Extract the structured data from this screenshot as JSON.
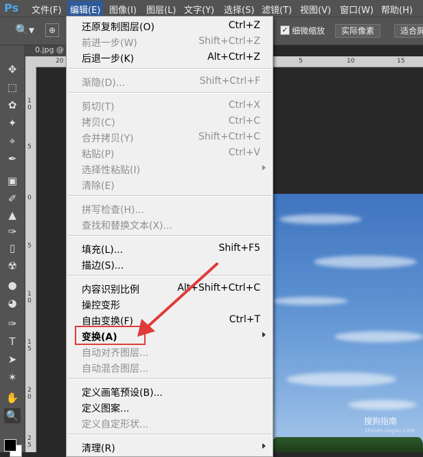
{
  "app": {
    "logo": "Ps"
  },
  "menubar": {
    "items": [
      "文件(F)",
      "编辑(E)",
      "图像(I)",
      "图层(L)",
      "文字(Y)",
      "选择(S)",
      "滤镜(T)",
      "视图(V)",
      "窗口(W)",
      "帮助(H)"
    ],
    "active": "编辑(E)"
  },
  "options": {
    "checkbox_label": "细微缩放",
    "actual_pixels": "实际像素",
    "fit_screen": "适合屏"
  },
  "document": {
    "tab_label": "0.jpg @"
  },
  "ruler": {
    "top_ticks": [
      "20",
      "5",
      "10",
      "15"
    ],
    "left_ticks": [
      "0",
      "1\n0",
      "5",
      "0",
      "5",
      "1\n0",
      "1\n5",
      "2\n0",
      "2\n5"
    ]
  },
  "edit_menu": {
    "items": [
      {
        "label": "还原复制图层(O)",
        "shortcut": "Ctrl+Z",
        "disabled": false
      },
      {
        "label": "前进一步(W)",
        "shortcut": "Shift+Ctrl+Z",
        "disabled": true
      },
      {
        "label": "后退一步(K)",
        "shortcut": "Alt+Ctrl+Z",
        "disabled": false
      },
      {
        "label": "渐隐(D)...",
        "shortcut": "Shift+Ctrl+F",
        "disabled": true
      },
      {
        "label": "剪切(T)",
        "shortcut": "Ctrl+X",
        "disabled": true
      },
      {
        "label": "拷贝(C)",
        "shortcut": "Ctrl+C",
        "disabled": true
      },
      {
        "label": "合并拷贝(Y)",
        "shortcut": "Shift+Ctrl+C",
        "disabled": true
      },
      {
        "label": "粘贴(P)",
        "shortcut": "Ctrl+V",
        "disabled": true
      },
      {
        "label": "选择性粘贴(I)",
        "shortcut": "",
        "disabled": true
      },
      {
        "label": "清除(E)",
        "shortcut": "",
        "disabled": true
      },
      {
        "label": "拼写检查(H)...",
        "shortcut": "",
        "disabled": true
      },
      {
        "label": "查找和替换文本(X)...",
        "shortcut": "",
        "disabled": true
      },
      {
        "label": "填充(L)...",
        "shortcut": "Shift+F5",
        "disabled": false
      },
      {
        "label": "描边(S)...",
        "shortcut": "",
        "disabled": false
      },
      {
        "label": "内容识别比例",
        "shortcut": "Alt+Shift+Ctrl+C",
        "disabled": false
      },
      {
        "label": "操控变形",
        "shortcut": "",
        "disabled": false
      },
      {
        "label": "自由变换(F)",
        "shortcut": "Ctrl+T",
        "disabled": false
      },
      {
        "label": "变换(A)",
        "shortcut": "",
        "disabled": false
      },
      {
        "label": "自动对齐图层...",
        "shortcut": "",
        "disabled": true
      },
      {
        "label": "自动混合图层...",
        "shortcut": "",
        "disabled": true
      },
      {
        "label": "定义画笔预设(B)...",
        "shortcut": "",
        "disabled": false
      },
      {
        "label": "定义图案...",
        "shortcut": "",
        "disabled": false
      },
      {
        "label": "定义自定形状...",
        "shortcut": "",
        "disabled": true
      },
      {
        "label": "清理(R)",
        "shortcut": "",
        "disabled": false
      }
    ]
  },
  "watermark": {
    "text": "搜狗指南",
    "sub": "zhinan.sogou.com"
  },
  "colors": {
    "highlight": "#e03a3a",
    "menu_bg": "#f0f0f0",
    "menubar_active": "#2f5b9a"
  },
  "tools": [
    "move-icon",
    "marquee-icon",
    "lasso-icon",
    "magic-wand-icon",
    "crop-icon",
    "eyedropper-icon",
    "healing-icon",
    "brush-icon",
    "stamp-icon",
    "history-brush-icon",
    "eraser-icon",
    "paint-bucket-icon",
    "blur-icon",
    "dodge-icon",
    "pen-icon",
    "type-icon",
    "path-select-icon",
    "shape-icon",
    "hand-icon",
    "zoom-icon"
  ]
}
